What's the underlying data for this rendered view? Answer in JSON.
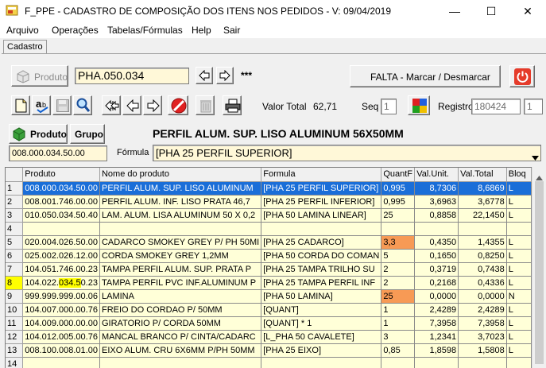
{
  "window": {
    "title": "F_PPE - CADASTRO DE COMPOSIÇÃO DOS ITENS NOS PEDIDOS - V: 09/04/2019",
    "minimize": "—",
    "maximize": "☐",
    "close": "✕"
  },
  "menu": [
    "Arquivo",
    "Operações",
    "Tabelas/Fórmulas",
    "Help",
    "Sair"
  ],
  "tab": "Cadastro",
  "toolbar1": {
    "produto_button": "Produto",
    "code": "PHA.050.034",
    "stars": "***",
    "falta_button": "FALTA - Marcar / Desmarcar"
  },
  "toolbar2": {
    "valor_total_label": "Valor Total",
    "valor_total": "62,71",
    "seq_label": "Seq",
    "seq": "1",
    "registro_label": "Registro",
    "registro": "180424",
    "registro2": "1"
  },
  "product": {
    "produto_button": "Produto",
    "grupo_button": "Grupo",
    "name": "PERFIL ALUM. SUP. LISO ALUMINUM 56X50MM",
    "code": "008.000.034.50.00",
    "formula_label": "Fórmula",
    "formula": "[PHA 25 PERFIL SUPERIOR]"
  },
  "grid": {
    "columns": [
      "Produto",
      "Nome do produto",
      "Formula",
      "QuantF",
      "Val.Unit.",
      "Val.Total",
      "Bloq"
    ],
    "rows": [
      {
        "n": "1",
        "produto": "008.000.034.50.00",
        "nome": "PERFIL ALUM. SUP. LISO ALUMINUM",
        "formula": "[PHA 25 PERFIL SUPERIOR]",
        "quant": "0,995",
        "unit": "8,7306",
        "total": "8,6869",
        "bloq": "L"
      },
      {
        "n": "2",
        "produto": "008.001.746.00.00",
        "nome": "PERFIL ALUM. INF. LISO  PRATA 46,7",
        "formula": "[PHA 25 PERFIL INFERIOR]",
        "quant": "0,995",
        "unit": "3,6963",
        "total": "3,6778",
        "bloq": "L"
      },
      {
        "n": "3",
        "produto": "010.050.034.50.40",
        "nome": "LAM. ALUM. LISA ALUMINUM 50 X 0,2",
        "formula": "[PHA 50 LAMINA LINEAR]",
        "quant": "25",
        "unit": "0,8858",
        "total": "22,1450",
        "bloq": "L"
      },
      {
        "n": "4",
        "produto": "",
        "nome": "",
        "formula": "",
        "quant": "",
        "unit": "",
        "total": "",
        "bloq": ""
      },
      {
        "n": "5",
        "produto": "020.004.026.50.00",
        "nome": "CADARCO SMOKEY GREY P/ PH 50MI",
        "formula": "[PHA 25 CADARCO]",
        "quant": "3,3",
        "unit": "0,4350",
        "total": "1,4355",
        "bloq": "L"
      },
      {
        "n": "6",
        "produto": "025.002.026.12.00",
        "nome": "CORDA SMOKEY GREY 1,2MM",
        "formula": "[PHA 50 CORDA DO COMAN",
        "quant": "5",
        "unit": "0,1650",
        "total": "0,8250",
        "bloq": "L"
      },
      {
        "n": "7",
        "produto": "104.051.746.00.23",
        "nome": "TAMPA PERFIL ALUM. SUP. PRATA P",
        "formula": "[PHA 25 TAMPA TRILHO SU",
        "quant": "2",
        "unit": "0,3719",
        "total": "0,7438",
        "bloq": "L"
      },
      {
        "n": "8",
        "produto_a": "104.022.",
        "produto_b": "034.5",
        "produto_c": "0.23",
        "nome": "TAMPA PERFIL PVC INF.ALUMINUM P",
        "formula": "[PHA 25 TAMPA PERFIL INF",
        "quant": "2",
        "unit": "0,2168",
        "total": "0,4336",
        "bloq": "L"
      },
      {
        "n": "9",
        "produto": "999.999.999.00.06",
        "nome": "LAMINA",
        "formula": "[PHA 50 LAMINA]",
        "quant": "25",
        "unit": "0,0000",
        "total": "0,0000",
        "bloq": "N"
      },
      {
        "n": "10",
        "produto": "104.007.000.00.76",
        "nome": "FREIO DO CORDAO P/ 50MM",
        "formula": "[QUANT]",
        "quant": "1",
        "unit": "2,4289",
        "total": "2,4289",
        "bloq": "L"
      },
      {
        "n": "11",
        "produto": "104.009.000.00.00",
        "nome": "GIRATORIO P/ CORDA 50MM",
        "formula": "[QUANT] * 1",
        "quant": "1",
        "unit": "7,3958",
        "total": "7,3958",
        "bloq": "L"
      },
      {
        "n": "12",
        "produto": "104.012.005.00.76",
        "nome": "MANCAL BRANCO P/ CINTA/CADARC",
        "formula": "[L_PHA 50 CAVALETE]",
        "quant": "3",
        "unit": "1,2341",
        "total": "3,7023",
        "bloq": "L"
      },
      {
        "n": "13",
        "produto": "008.100.008.01.00",
        "nome": "EIXO ALUM. CRU 6X6MM P/PH 50MM",
        "formula": "[PHA 25 EIXO]",
        "quant": "0,85",
        "unit": "1,8598",
        "total": "1,5808",
        "bloq": "L"
      },
      {
        "n": "14",
        "produto": "",
        "nome": "",
        "formula": "",
        "quant": "",
        "unit": "",
        "total": "",
        "bloq": ""
      }
    ]
  },
  "colors": {
    "selection": "#1a6ed8",
    "row_bg": "#ffffd8",
    "orange": "#f79a55",
    "highlight": "#ffff00",
    "power": "#e53b2a"
  }
}
